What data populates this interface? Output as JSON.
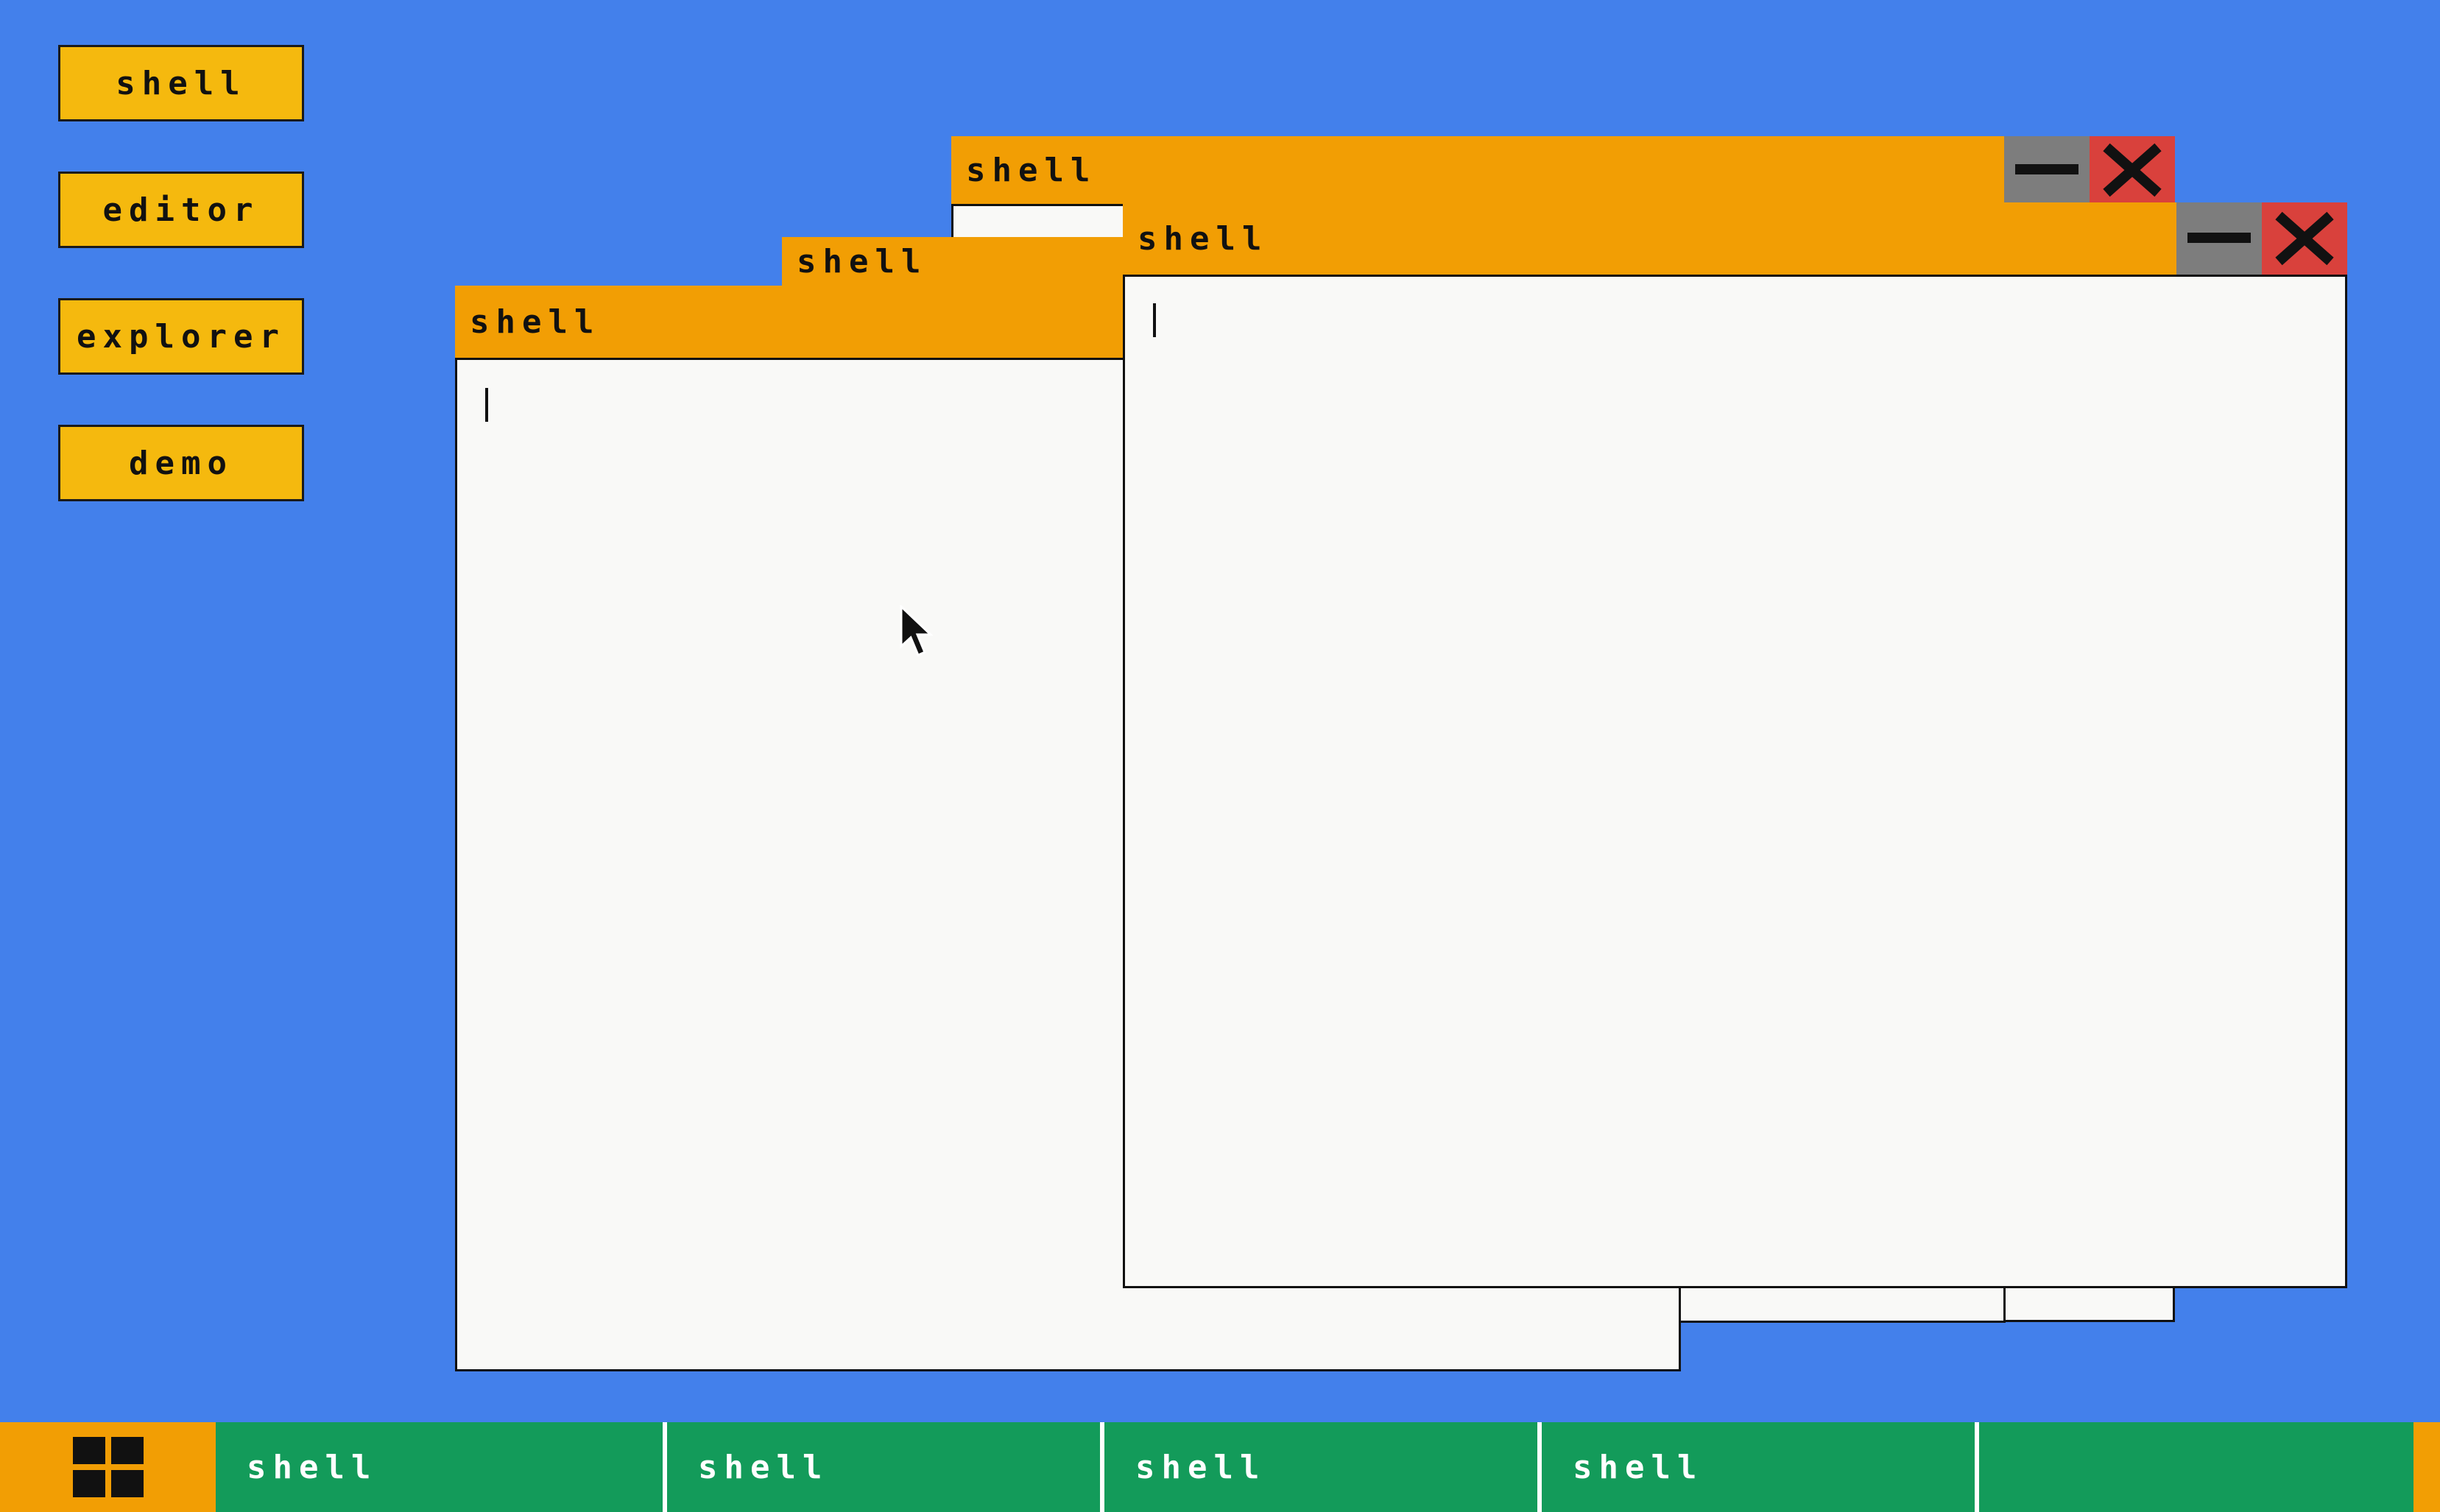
{
  "desktop": {
    "background_color": "#4380eb",
    "launchers": [
      {
        "label": "shell"
      },
      {
        "label": "editor"
      },
      {
        "label": "explorer"
      },
      {
        "label": "demo"
      }
    ]
  },
  "windows": [
    {
      "title": "shell",
      "minimize_icon": "minimize-icon",
      "close_icon": "close-icon"
    },
    {
      "title": "shell"
    },
    {
      "title": "shell"
    },
    {
      "title": "shell",
      "minimize_icon": "minimize-icon",
      "close_icon": "close-icon"
    }
  ],
  "taskbar": {
    "start_icon": "grid-icon",
    "items": [
      {
        "label": "shell"
      },
      {
        "label": "shell"
      },
      {
        "label": "shell"
      },
      {
        "label": "shell"
      }
    ]
  },
  "colors": {
    "accent_orange": "#f29e04",
    "launcher_yellow": "#f5b90e",
    "taskbar_green": "#139b5a",
    "close_red": "#d9413c",
    "minimize_gray": "#7d7d7d",
    "window_body": "#f9f9f7"
  }
}
